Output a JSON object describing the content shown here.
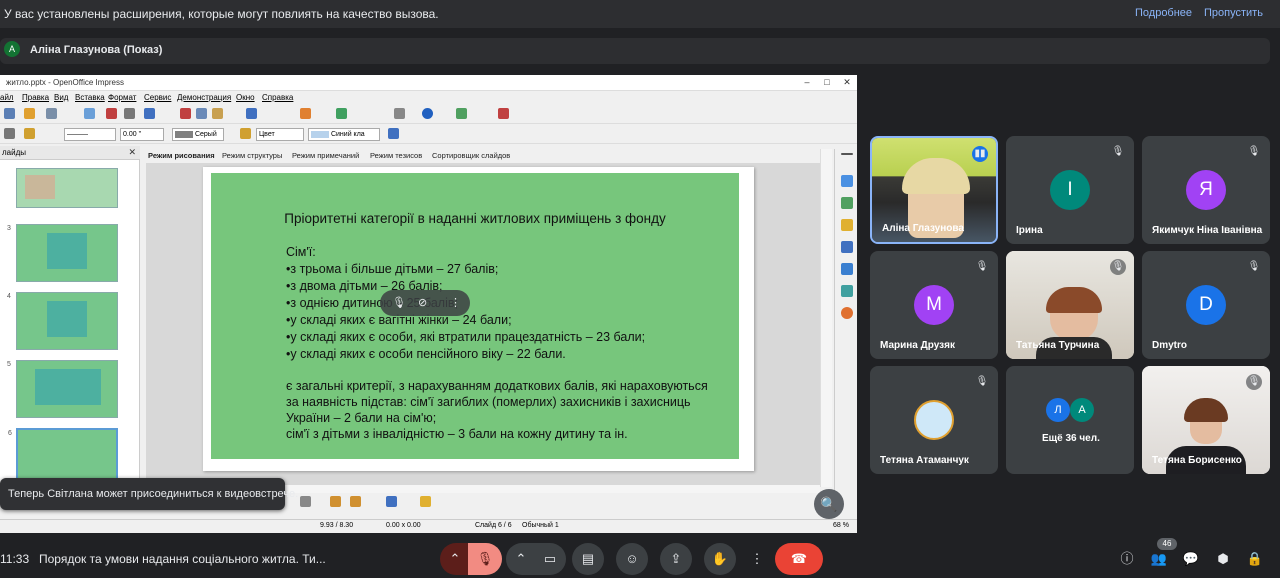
{
  "notification": {
    "message": "У вас установлены расширения, которые могут повлиять на качество вызова.",
    "details_link": "Подробнее",
    "skip_link": "Пропустить"
  },
  "presenter": {
    "initial": "А",
    "label": "Аліна Глазунова (Показ)"
  },
  "shared_window": {
    "title": "житло.pptx - OpenOffice Impress",
    "menu": [
      "айл",
      "Правка",
      "Вид",
      "Вставка",
      "Формат",
      "Сервис",
      "Демонстрация",
      "Окно",
      "Справка"
    ],
    "line_width": "0.00 \"",
    "line_color": "Серый",
    "fill_type": "Цвет",
    "fill_color": "Синий кла",
    "slides_panel_title": "лайды",
    "slide_numbers": [
      "3",
      "4",
      "5",
      "6"
    ],
    "view_tabs": [
      "Режим рисования",
      "Режим структуры",
      "Режим примечаний",
      "Режим тезисов",
      "Сортировщик слайдов"
    ],
    "status": {
      "position": "9.93 / 8.30",
      "size": "0.00 x 0.00",
      "slide": "Слайд 6 / 6",
      "layout": "Обычный 1",
      "zoom": "68 %"
    },
    "slide": {
      "title": "Пріоритетні категорії в наданні житлових приміщень з фонду",
      "lines": [
        "Сім'ї:",
        "•з трьома і більше дітьми – 27 балів;",
        "•з двома дітьми – 26 балів;",
        "•з однією дитиною – 25 балів;",
        "•у складі яких є вагітні жінки – 24 бали;",
        "•у складі яких є особи, які втратили працездатність – 23 бали;",
        "•у складі яких є особи пенсійного віку – 22 бали.",
        "є загальні критерії, з нарахуванням додаткових балів, які нараховуються",
        "за наявність підстав: сім'ї загиблих (померлих) захисників і захисниць",
        "України – 2 бали на сім'ю;",
        "сім'ї з дітьми з інвалідністю – 3 бали на кожну дитину та ін."
      ]
    }
  },
  "toast": "Теперь Світлана может присоединиться к видеовстрече.",
  "participants": [
    {
      "name": "Аліна Глазунова",
      "type": "video",
      "speaking": true
    },
    {
      "name": "Ірина",
      "initial": "І",
      "color": "#00897b",
      "muted": true
    },
    {
      "name": "Якимчук Ніна Іванівна",
      "initial": "Я",
      "color": "#a142f4",
      "muted": true
    },
    {
      "name": "Марина Друзяк",
      "initial": "М",
      "color": "#a142f4",
      "muted": true
    },
    {
      "name": "Татьяна Турчина",
      "type": "video",
      "muted": true
    },
    {
      "name": "Dmytro",
      "initial": "D",
      "color": "#1a73e8",
      "muted": true
    },
    {
      "name": "Тетяна Атаманчук",
      "type": "avatar-image",
      "muted": true
    },
    {
      "name": "Ещё 36 чел.",
      "initials": [
        "Л",
        "А"
      ]
    },
    {
      "name": "Тетяна Борисенко",
      "type": "video",
      "muted": true
    }
  ],
  "bottom": {
    "time": "11:33",
    "meeting_title": "Порядок та умови надання соціального житла. Ти...",
    "participant_count": "46"
  },
  "colors": {
    "background": "#202124",
    "hangup": "#ea4335",
    "slide_green": "#77c67c",
    "link": "#8ab4f8"
  }
}
